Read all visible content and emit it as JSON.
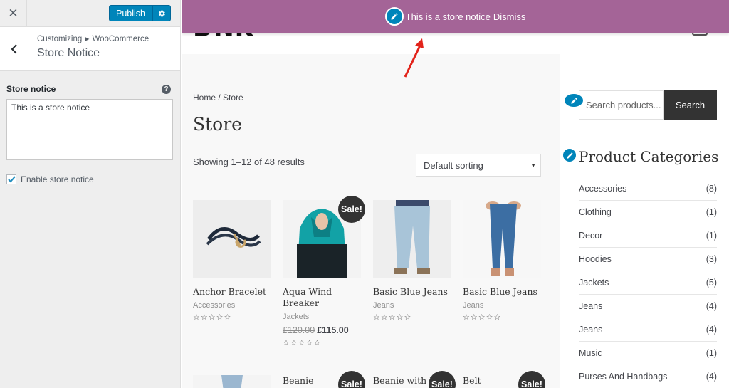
{
  "sidebar": {
    "publish_label": "Publish",
    "breadcrumb_root": "Customizing",
    "breadcrumb_parent": "WooCommerce",
    "section_title": "Store Notice",
    "field_label": "Store notice",
    "field_value": "This is a store notice",
    "enable_label": "Enable store notice",
    "enable_checked": true
  },
  "notice": {
    "text": "This is a store notice",
    "dismiss_label": "Dismiss",
    "background_color": "#a46497"
  },
  "site": {
    "logo_text": "DNK"
  },
  "shop": {
    "breadcrumb_home": "Home",
    "breadcrumb_sep": " / ",
    "breadcrumb_current": "Store",
    "title": "Store",
    "result_count": "Showing 1–12 of 48 results",
    "sort_selected": "Default sorting",
    "stars": "☆☆☆☆☆",
    "products": [
      {
        "name": "Anchor Bracelet",
        "category": "Accessories",
        "sale": false,
        "price": "",
        "old_price": ""
      },
      {
        "name": "Aqua Wind Breaker",
        "category": "Jackets",
        "sale": true,
        "price": "£115.00",
        "old_price": "£120.00"
      },
      {
        "name": "Basic Blue Jeans",
        "category": "Jeans",
        "sale": false,
        "price": "",
        "old_price": ""
      },
      {
        "name": "Basic Blue Jeans",
        "category": "Jeans",
        "sale": false,
        "price": "",
        "old_price": ""
      }
    ],
    "row2": [
      {
        "name": "",
        "sale": false
      },
      {
        "name": "Beanie",
        "sale": true
      },
      {
        "name": "Beanie with L",
        "sale": true
      },
      {
        "name": "Belt",
        "sale": true
      }
    ],
    "sale_label": "Sale!"
  },
  "widgets": {
    "search_placeholder": "Search products...",
    "search_button": "Search",
    "categories_title": "Product Categories",
    "categories": [
      {
        "name": "Accessories",
        "count": "(8)"
      },
      {
        "name": "Clothing",
        "count": "(1)"
      },
      {
        "name": "Decor",
        "count": "(1)"
      },
      {
        "name": "Hoodies",
        "count": "(3)"
      },
      {
        "name": "Jackets",
        "count": "(5)"
      },
      {
        "name": "Jeans",
        "count": "(4)"
      },
      {
        "name": "Jeans",
        "count": "(4)"
      },
      {
        "name": "Music",
        "count": "(1)"
      },
      {
        "name": "Purses And Handbags",
        "count": "(4)"
      }
    ]
  },
  "colors": {
    "accent_blue": "#0085ba",
    "annotation_arrow": "#e2231a"
  },
  "icons": {
    "close": "close-icon",
    "gear": "gear-icon",
    "back": "chevron-left-icon",
    "help": "help-icon",
    "edit": "pencil-icon"
  }
}
